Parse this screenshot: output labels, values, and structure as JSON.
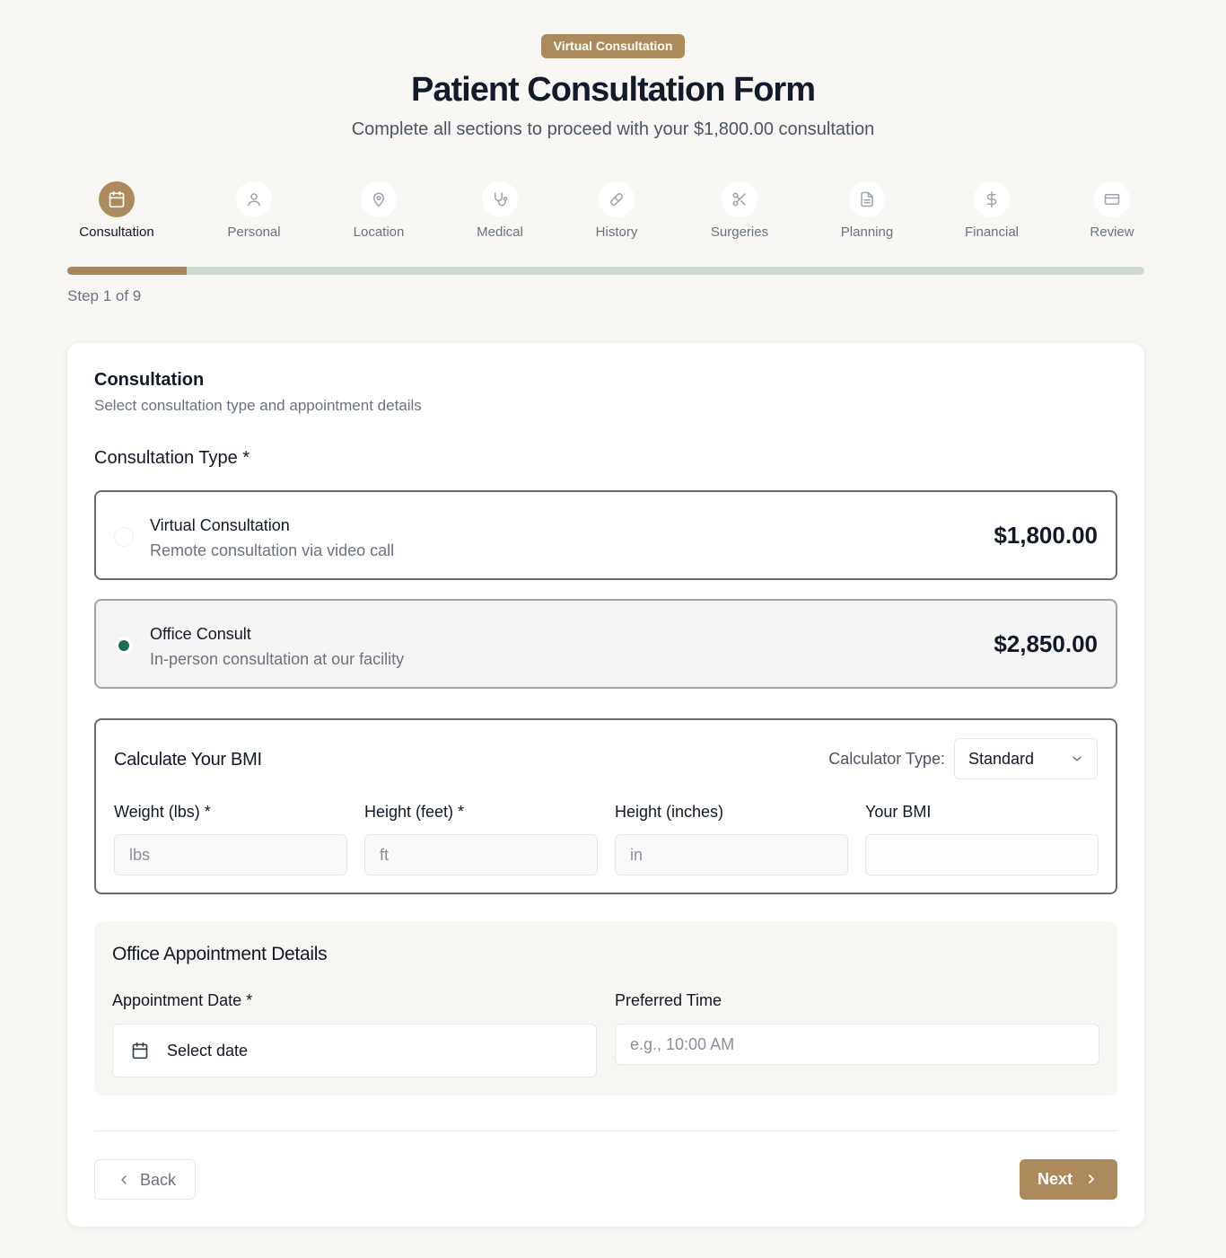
{
  "header": {
    "badge": "Virtual Consultation",
    "title": "Patient Consultation Form",
    "subtitle": "Complete all sections to proceed with your $1,800.00 consultation"
  },
  "steps": [
    {
      "label": "Consultation",
      "icon": "calendar-icon",
      "active": true
    },
    {
      "label": "Personal",
      "icon": "user-icon",
      "active": false
    },
    {
      "label": "Location",
      "icon": "map-pin-icon",
      "active": false
    },
    {
      "label": "Medical",
      "icon": "stethoscope-icon",
      "active": false
    },
    {
      "label": "History",
      "icon": "pill-icon",
      "active": false
    },
    {
      "label": "Surgeries",
      "icon": "scissors-icon",
      "active": false
    },
    {
      "label": "Planning",
      "icon": "document-icon",
      "active": false
    },
    {
      "label": "Financial",
      "icon": "dollar-icon",
      "active": false
    },
    {
      "label": "Review",
      "icon": "credit-card-icon",
      "active": false
    }
  ],
  "progress": {
    "fraction": 0.111,
    "label": "Step 1 of 9"
  },
  "section": {
    "title": "Consultation",
    "description": "Select consultation type and appointment details"
  },
  "consultation_type": {
    "label": "Consultation Type *",
    "options": [
      {
        "name": "Virtual Consultation",
        "description": "Remote consultation via video call",
        "price": "$1,800.00",
        "selected": false
      },
      {
        "name": "Office Consult",
        "description": "In-person consultation at our facility",
        "price": "$2,850.00",
        "selected": true
      }
    ]
  },
  "bmi": {
    "title": "Calculate Your BMI",
    "calculator_label": "Calculator Type:",
    "calculator_value": "Standard",
    "fields": [
      {
        "label": "Weight (lbs) *",
        "placeholder": "lbs"
      },
      {
        "label": "Height (feet) *",
        "placeholder": "ft"
      },
      {
        "label": "Height (inches)",
        "placeholder": "in"
      },
      {
        "label": "Your BMI",
        "placeholder": ""
      }
    ]
  },
  "appointment": {
    "title": "Office Appointment Details",
    "date_label": "Appointment Date *",
    "date_value": "Select date",
    "time_label": "Preferred Time",
    "time_placeholder": "e.g., 10:00 AM"
  },
  "nav": {
    "back": "Back",
    "next": "Next"
  },
  "colors": {
    "accent": "#ad8a5c",
    "radio": "#1f6b54",
    "progress_track": "#cddcd3"
  }
}
